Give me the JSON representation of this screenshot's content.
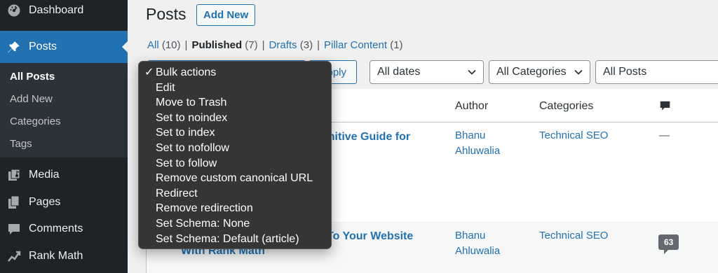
{
  "sidebar": {
    "items": [
      {
        "label": "Dashboard",
        "icon": "dashboard-icon"
      },
      {
        "label": "Posts",
        "icon": "pushpin-icon"
      },
      {
        "label": "Media",
        "icon": "media-icon"
      },
      {
        "label": "Pages",
        "icon": "pages-icon"
      },
      {
        "label": "Comments",
        "icon": "comments-icon"
      },
      {
        "label": "Rank Math",
        "icon": "rank-math-icon"
      }
    ],
    "submenu": [
      "All Posts",
      "Add New",
      "Categories",
      "Tags"
    ]
  },
  "header": {
    "title": "Posts",
    "add_new": "Add New"
  },
  "filters": {
    "all": "All",
    "all_count": "(10)",
    "published": "Published",
    "published_count": "(7)",
    "drafts": "Drafts",
    "drafts_count": "(3)",
    "pillar": "Pillar Content",
    "pillar_count": "(1)",
    "separator": "|"
  },
  "toolbar": {
    "apply": "Apply",
    "dates": "All dates",
    "categories": "All Categories",
    "post_filter": "All Posts"
  },
  "table": {
    "headers": {
      "author": "Author",
      "categories": "Categories"
    },
    "rows": [
      {
        "title_fragment": "finitive Guide for",
        "author_line1": "Bhanu",
        "author_line2": "Ahluwalia",
        "category": "Technical SEO",
        "comments": "—"
      },
      {
        "title_fragment": "’ To Your Website",
        "title_line2": "With Rank Math",
        "author_line1": "Bhanu",
        "author_line2": "Ahluwalia",
        "category": "Technical SEO",
        "comments": "63"
      }
    ]
  },
  "bulk_menu": {
    "checkmark": "✓",
    "options": [
      "Bulk actions",
      "Edit",
      "Move to Trash",
      "Set to noindex",
      "Set to index",
      "Set to nofollow",
      "Set to follow",
      "Remove custom canonical URL",
      "Redirect",
      "Remove redirection",
      "Set Schema: None",
      "Set Schema: Default (article)"
    ]
  },
  "colors": {
    "sidebar_bg": "#1d2327",
    "accent": "#2271b1",
    "menu_bg": "#353535"
  }
}
